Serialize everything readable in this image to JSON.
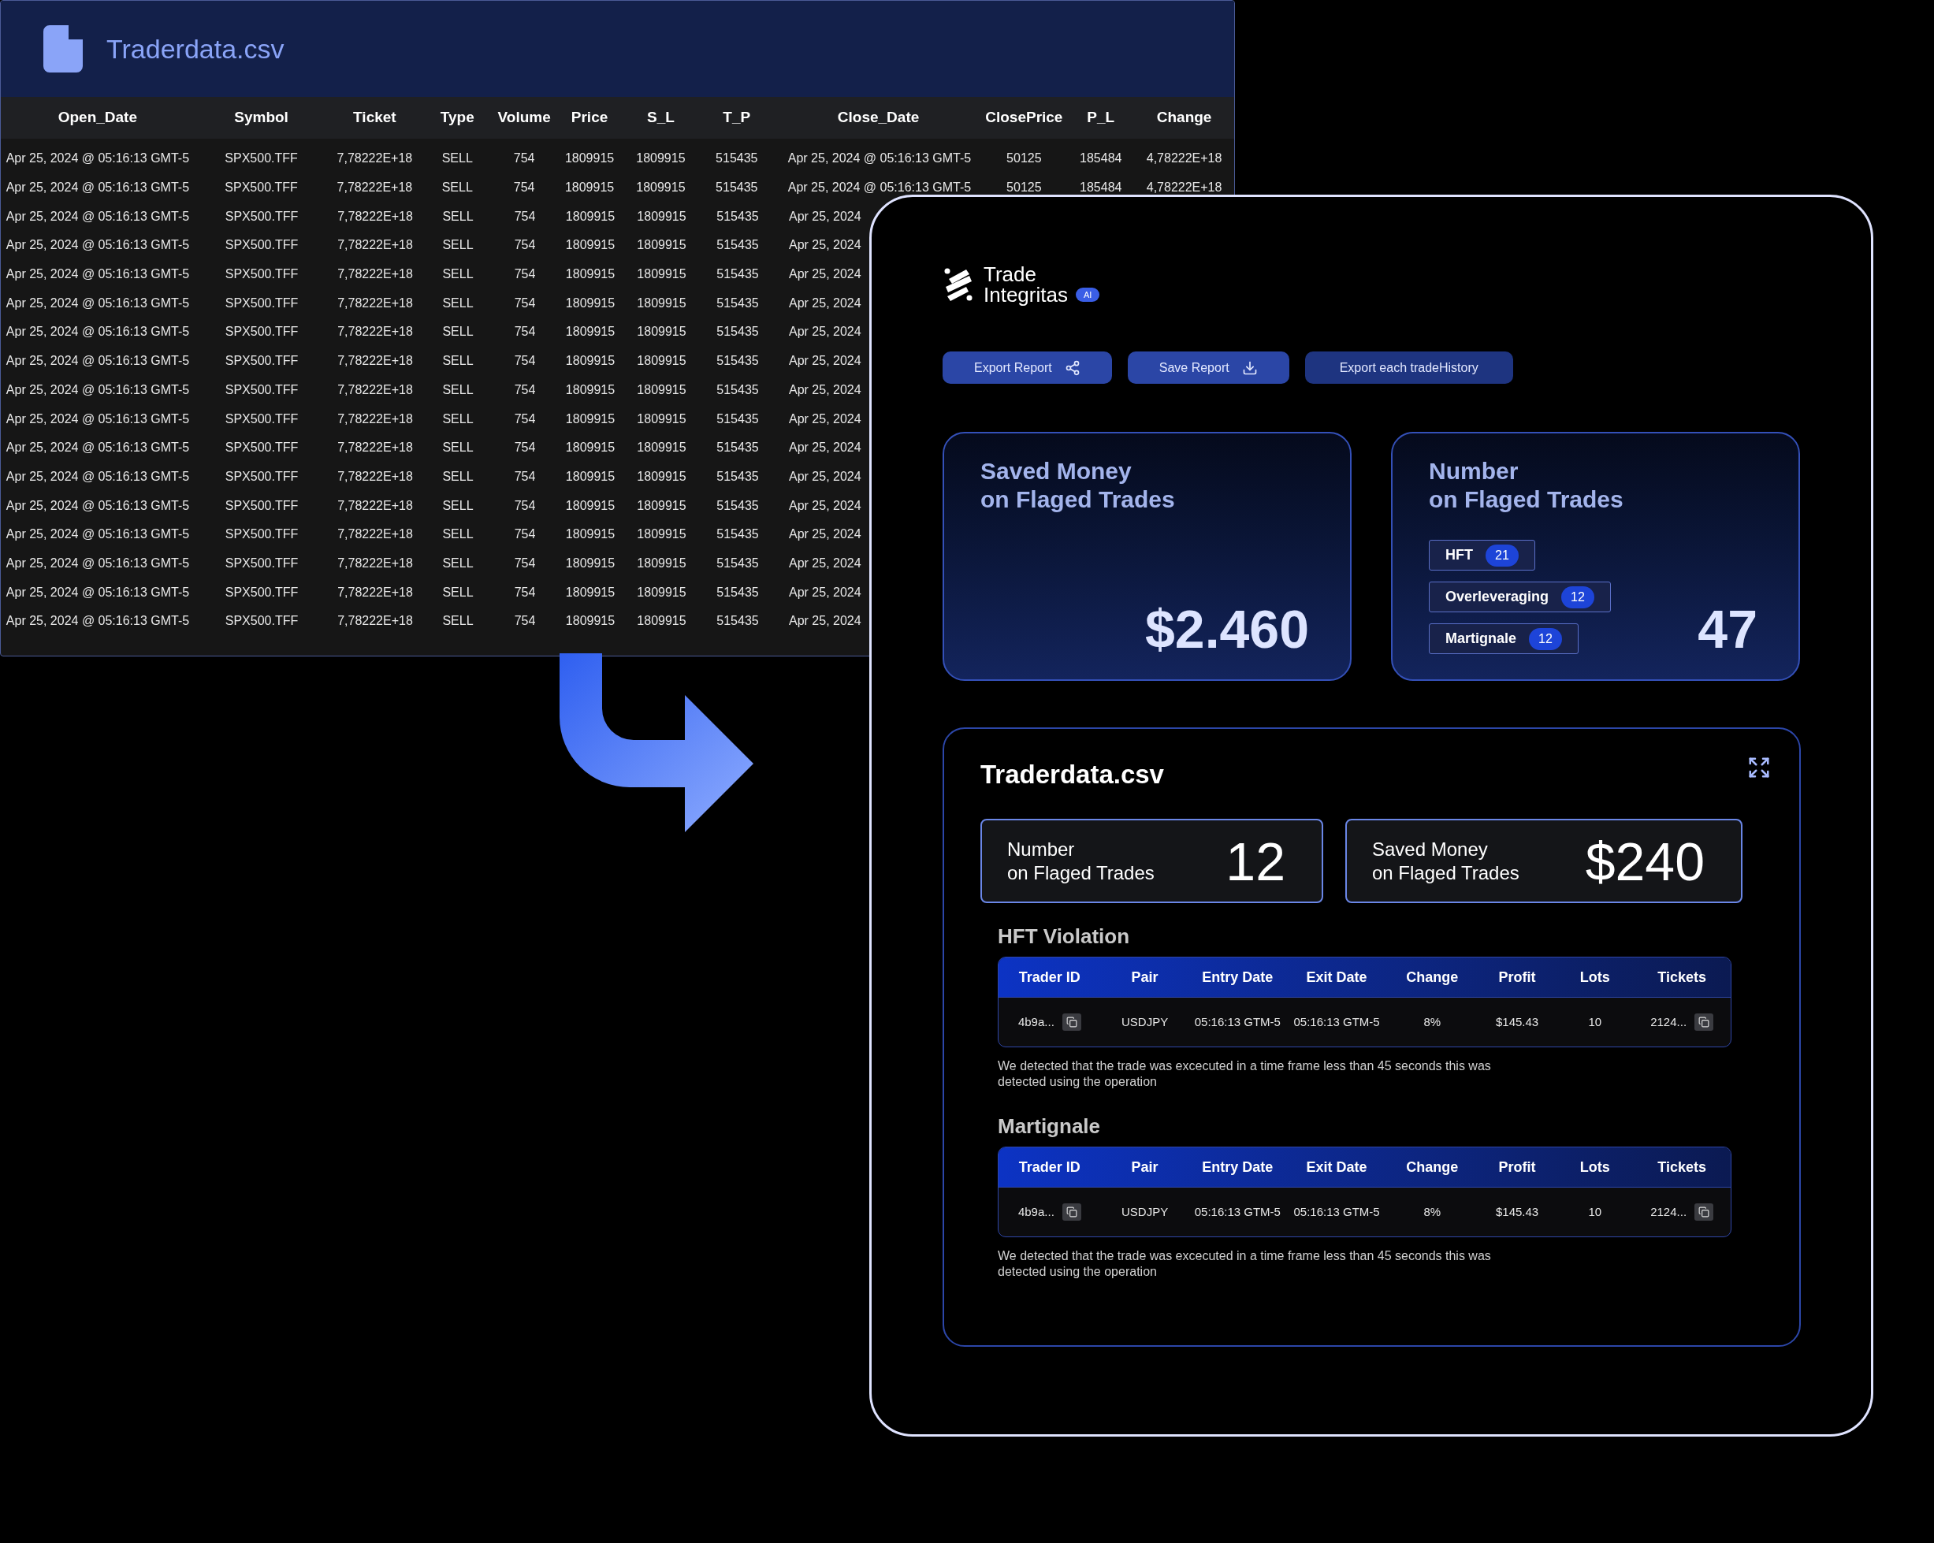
{
  "csv_window": {
    "title": "Traderdata.csv",
    "columns": [
      "Open_Date",
      "Symbol",
      "Ticket",
      "Type",
      "Volume",
      "Price",
      "S_L",
      "T_P",
      "Close_Date",
      "ClosePrice",
      "P_L",
      "Change"
    ],
    "rows": [
      [
        "Apr 25, 2024 @ 05:16:13 GMT-5",
        "SPX500.TFF",
        "7,78222E+18",
        "SELL",
        "754",
        "1809915",
        "1809915",
        "515435",
        "Apr 25, 2024 @ 05:16:13 GMT-5",
        "50125",
        "185484",
        "4,78222E+18"
      ],
      [
        "Apr 25, 2024 @ 05:16:13 GMT-5",
        "SPX500.TFF",
        "7,78222E+18",
        "SELL",
        "754",
        "1809915",
        "1809915",
        "515435",
        "Apr 25, 2024 @ 05:16:13 GMT-5",
        "50125",
        "185484",
        "4,78222E+18"
      ],
      [
        "Apr 25, 2024 @ 05:16:13 GMT-5",
        "SPX500.TFF",
        "7,78222E+18",
        "SELL",
        "754",
        "1809915",
        "1809915",
        "515435",
        "Apr 25, 2024"
      ],
      [
        "Apr 25, 2024 @ 05:16:13 GMT-5",
        "SPX500.TFF",
        "7,78222E+18",
        "SELL",
        "754",
        "1809915",
        "1809915",
        "515435",
        "Apr 25, 2024"
      ],
      [
        "Apr 25, 2024 @ 05:16:13 GMT-5",
        "SPX500.TFF",
        "7,78222E+18",
        "SELL",
        "754",
        "1809915",
        "1809915",
        "515435",
        "Apr 25, 2024"
      ],
      [
        "Apr 25, 2024 @ 05:16:13 GMT-5",
        "SPX500.TFF",
        "7,78222E+18",
        "SELL",
        "754",
        "1809915",
        "1809915",
        "515435",
        "Apr 25, 2024"
      ],
      [
        "Apr 25, 2024 @ 05:16:13 GMT-5",
        "SPX500.TFF",
        "7,78222E+18",
        "SELL",
        "754",
        "1809915",
        "1809915",
        "515435",
        "Apr 25, 2024"
      ],
      [
        "Apr 25, 2024 @ 05:16:13 GMT-5",
        "SPX500.TFF",
        "7,78222E+18",
        "SELL",
        "754",
        "1809915",
        "1809915",
        "515435",
        "Apr 25, 2024"
      ],
      [
        "Apr 25, 2024 @ 05:16:13 GMT-5",
        "SPX500.TFF",
        "7,78222E+18",
        "SELL",
        "754",
        "1809915",
        "1809915",
        "515435",
        "Apr 25, 2024"
      ],
      [
        "Apr 25, 2024 @ 05:16:13 GMT-5",
        "SPX500.TFF",
        "7,78222E+18",
        "SELL",
        "754",
        "1809915",
        "1809915",
        "515435",
        "Apr 25, 2024"
      ],
      [
        "Apr 25, 2024 @ 05:16:13 GMT-5",
        "SPX500.TFF",
        "7,78222E+18",
        "SELL",
        "754",
        "1809915",
        "1809915",
        "515435",
        "Apr 25, 2024"
      ],
      [
        "Apr 25, 2024 @ 05:16:13 GMT-5",
        "SPX500.TFF",
        "7,78222E+18",
        "SELL",
        "754",
        "1809915",
        "1809915",
        "515435",
        "Apr 25, 2024"
      ],
      [
        "Apr 25, 2024 @ 05:16:13 GMT-5",
        "SPX500.TFF",
        "7,78222E+18",
        "SELL",
        "754",
        "1809915",
        "1809915",
        "515435",
        "Apr 25, 2024"
      ],
      [
        "Apr 25, 2024 @ 05:16:13 GMT-5",
        "SPX500.TFF",
        "7,78222E+18",
        "SELL",
        "754",
        "1809915",
        "1809915",
        "515435",
        "Apr 25, 2024"
      ],
      [
        "Apr 25, 2024 @ 05:16:13 GMT-5",
        "SPX500.TFF",
        "7,78222E+18",
        "SELL",
        "754",
        "1809915",
        "1809915",
        "515435",
        "Apr 25, 2024"
      ],
      [
        "Apr 25, 2024 @ 05:16:13 GMT-5",
        "SPX500.TFF",
        "7,78222E+18",
        "SELL",
        "754",
        "1809915",
        "1809915",
        "515435",
        "Apr 25, 2024"
      ],
      [
        "Apr 25, 2024 @ 05:16:13 GMT-5",
        "SPX500.TFF",
        "7,78222E+18",
        "SELL",
        "754",
        "1809915",
        "1809915",
        "515435",
        "Apr 25, 2024"
      ]
    ]
  },
  "report": {
    "logo": {
      "line1": "Trade",
      "line2": "Integritas",
      "badge": "AI"
    },
    "buttons": [
      {
        "label": "Export Report",
        "kind": "share"
      },
      {
        "label": "Save Report",
        "kind": "download"
      },
      {
        "label": "Export each tradeHistory",
        "kind": "plain"
      }
    ],
    "summary_cards": [
      {
        "title_lines": [
          "Saved Money",
          "on Flaged Trades"
        ],
        "value": "$2.460"
      },
      {
        "title_lines": [
          "Number",
          "on Flaged Trades"
        ],
        "value": "47",
        "tags": [
          {
            "label": "HFT",
            "count": "21"
          },
          {
            "label": "Overleveraging",
            "count": "12"
          },
          {
            "label": "Martignale",
            "count": "12"
          }
        ]
      }
    ],
    "file_section": {
      "title": "Traderdata.csv",
      "stats": [
        {
          "label_lines": [
            "Number",
            "on Flaged Trades"
          ],
          "value": "12"
        },
        {
          "label_lines": [
            "Saved Money",
            "on Flaged Trades"
          ],
          "value": "$240"
        }
      ],
      "violations": [
        {
          "title": "HFT Violation",
          "columns": [
            "Trader ID",
            "Pair",
            "Entry Date",
            "Exit Date",
            "Change",
            "Profit",
            "Lots",
            "Tickets"
          ],
          "rows": [
            [
              {
                "text": "4b9a...",
                "copy": true
              },
              {
                "text": "USDJPY",
                "copy": false
              },
              {
                "text": "05:16:13 GTM-5",
                "copy": false
              },
              {
                "text": "05:16:13 GTM-5",
                "copy": false
              },
              {
                "text": "8%",
                "copy": false
              },
              {
                "text": "$145.43",
                "copy": false
              },
              {
                "text": "10",
                "copy": false
              },
              {
                "text": "2124...",
                "copy": true
              }
            ]
          ],
          "note": "We detected that the trade was excecuted in a time frame less than 45 seconds this was detected using the operation"
        },
        {
          "title": "Martignale",
          "columns": [
            "Trader ID",
            "Pair",
            "Entry Date",
            "Exit Date",
            "Change",
            "Profit",
            "Lots",
            "Tickets"
          ],
          "rows": [
            [
              {
                "text": "4b9a...",
                "copy": true
              },
              {
                "text": "USDJPY",
                "copy": false
              },
              {
                "text": "05:16:13 GTM-5",
                "copy": false
              },
              {
                "text": "05:16:13 GTM-5",
                "copy": false
              },
              {
                "text": "8%",
                "copy": false
              },
              {
                "text": "$145.43",
                "copy": false
              },
              {
                "text": "10",
                "copy": false
              },
              {
                "text": "2124...",
                "copy": true
              }
            ]
          ],
          "note": "We detected that the trade was excecuted in a time frame less than 45 seconds this was detected using the operation"
        }
      ]
    }
  }
}
